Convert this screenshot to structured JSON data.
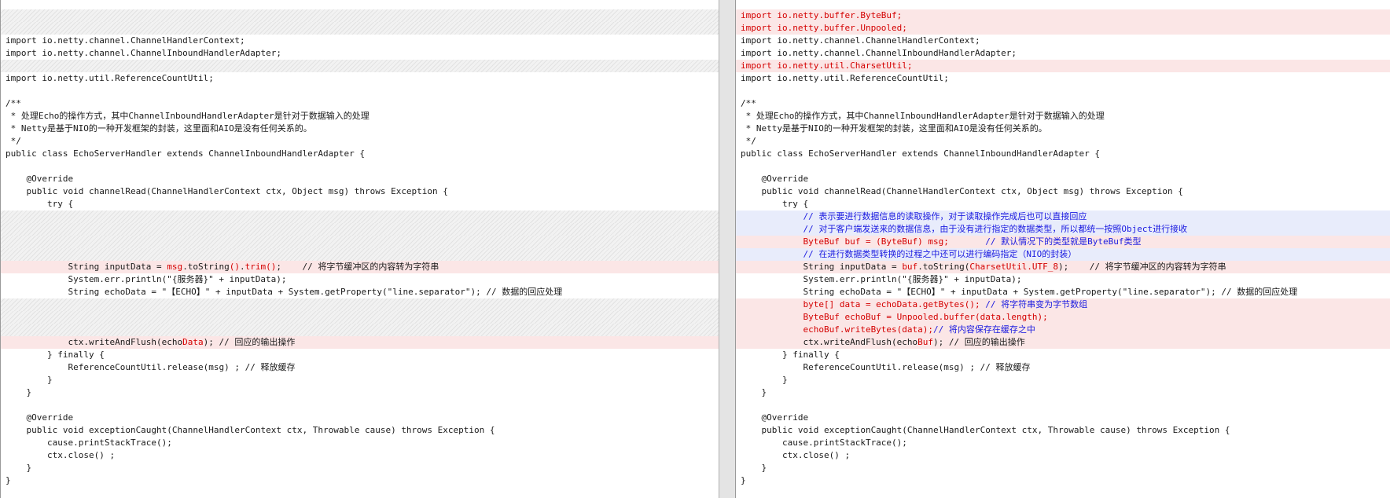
{
  "left": {
    "lines": [
      {
        "kind": "gap"
      },
      {
        "kind": "gap"
      },
      {
        "kind": "normal",
        "segments": [
          {
            "t": "import io.netty.channel.ChannelHandlerContext;"
          }
        ]
      },
      {
        "kind": "normal",
        "segments": [
          {
            "t": "import io.netty.channel.ChannelInboundHandlerAdapter;"
          }
        ]
      },
      {
        "kind": "gap"
      },
      {
        "kind": "normal",
        "segments": [
          {
            "t": "import io.netty.util.ReferenceCountUtil;"
          }
        ]
      },
      {
        "kind": "blank"
      },
      {
        "kind": "normal",
        "segments": [
          {
            "t": "/**"
          }
        ]
      },
      {
        "kind": "normal",
        "segments": [
          {
            "t": " * 处理Echo的操作方式，其中ChannelInboundHandlerAdapter是针对于数据输入的处理"
          }
        ]
      },
      {
        "kind": "normal",
        "segments": [
          {
            "t": " * Netty是基于NIO的一种开发框架的封装，这里面和AIO是没有任何关系的。"
          }
        ]
      },
      {
        "kind": "normal",
        "segments": [
          {
            "t": " */"
          }
        ]
      },
      {
        "kind": "normal",
        "segments": [
          {
            "t": "public class EchoServerHandler extends ChannelInboundHandlerAdapter {"
          }
        ]
      },
      {
        "kind": "blank"
      },
      {
        "kind": "normal",
        "segments": [
          {
            "t": "    @Override"
          }
        ]
      },
      {
        "kind": "normal",
        "segments": [
          {
            "t": "    public void channelRead(ChannelHandlerContext ctx, Object msg) throws Exception {"
          }
        ]
      },
      {
        "kind": "normal",
        "segments": [
          {
            "t": "        try {"
          }
        ]
      },
      {
        "kind": "gap"
      },
      {
        "kind": "gap"
      },
      {
        "kind": "gap"
      },
      {
        "kind": "gap"
      },
      {
        "kind": "changed",
        "segments": [
          {
            "t": "            String inputData = "
          },
          {
            "t": "msg",
            "c": "red"
          },
          {
            "t": ".toString"
          },
          {
            "t": "()",
            "c": "red"
          },
          {
            "t": "."
          },
          {
            "t": "trim()",
            "c": "red"
          },
          {
            "t": ";    // 将字节缓冲区的内容转为字符串"
          }
        ]
      },
      {
        "kind": "normal",
        "segments": [
          {
            "t": "            System.err.println(\"{服务器}\" + inputData);"
          }
        ]
      },
      {
        "kind": "normal",
        "segments": [
          {
            "t": "            String echoData = \"【ECHO】\" + inputData + System.getProperty(\"line.separator\"); // 数据的回应处理"
          }
        ]
      },
      {
        "kind": "gap"
      },
      {
        "kind": "gap"
      },
      {
        "kind": "gap"
      },
      {
        "kind": "changed",
        "segments": [
          {
            "t": "            ctx.writeAndFlush(echo"
          },
          {
            "t": "Data",
            "c": "red"
          },
          {
            "t": "); // 回应的输出操作"
          }
        ]
      },
      {
        "kind": "normal",
        "segments": [
          {
            "t": "        } finally {"
          }
        ]
      },
      {
        "kind": "normal",
        "segments": [
          {
            "t": "            ReferenceCountUtil.release(msg) ; // 释放缓存"
          }
        ]
      },
      {
        "kind": "normal",
        "segments": [
          {
            "t": "        }"
          }
        ]
      },
      {
        "kind": "normal",
        "segments": [
          {
            "t": "    }"
          }
        ]
      },
      {
        "kind": "blank"
      },
      {
        "kind": "normal",
        "segments": [
          {
            "t": "    @Override"
          }
        ]
      },
      {
        "kind": "normal",
        "segments": [
          {
            "t": "    public void exceptionCaught(ChannelHandlerContext ctx, Throwable cause) throws Exception {"
          }
        ]
      },
      {
        "kind": "normal",
        "segments": [
          {
            "t": "        cause.printStackTrace();"
          }
        ]
      },
      {
        "kind": "normal",
        "segments": [
          {
            "t": "        ctx.close() ;"
          }
        ]
      },
      {
        "kind": "normal",
        "segments": [
          {
            "t": "    }"
          }
        ]
      },
      {
        "kind": "normal",
        "segments": [
          {
            "t": "}"
          }
        ]
      }
    ]
  },
  "right": {
    "lines": [
      {
        "kind": "added",
        "segments": [
          {
            "t": "import io.netty.buffer.ByteBuf;"
          }
        ]
      },
      {
        "kind": "added",
        "segments": [
          {
            "t": "import io.netty.buffer.Unpooled;"
          }
        ]
      },
      {
        "kind": "normal",
        "segments": [
          {
            "t": "import io.netty.channel.ChannelHandlerContext;"
          }
        ]
      },
      {
        "kind": "normal",
        "segments": [
          {
            "t": "import io.netty.channel.ChannelInboundHandlerAdapter;"
          }
        ]
      },
      {
        "kind": "added",
        "segments": [
          {
            "t": "import io.netty.util.CharsetUtil;"
          }
        ]
      },
      {
        "kind": "normal",
        "segments": [
          {
            "t": "import io.netty.util.ReferenceCountUtil;"
          }
        ]
      },
      {
        "kind": "blank"
      },
      {
        "kind": "normal",
        "segments": [
          {
            "t": "/**"
          }
        ]
      },
      {
        "kind": "normal",
        "segments": [
          {
            "t": " * 处理Echo的操作方式，其中ChannelInboundHandlerAdapter是针对于数据输入的处理"
          }
        ]
      },
      {
        "kind": "normal",
        "segments": [
          {
            "t": " * Netty是基于NIO的一种开发框架的封装，这里面和AIO是没有任何关系的。"
          }
        ]
      },
      {
        "kind": "normal",
        "segments": [
          {
            "t": " */"
          }
        ]
      },
      {
        "kind": "normal",
        "segments": [
          {
            "t": "public class EchoServerHandler extends ChannelInboundHandlerAdapter {"
          }
        ]
      },
      {
        "kind": "blank"
      },
      {
        "kind": "normal",
        "segments": [
          {
            "t": "    @Override"
          }
        ]
      },
      {
        "kind": "normal",
        "segments": [
          {
            "t": "    public void channelRead(ChannelHandlerContext ctx, Object msg) throws Exception {"
          }
        ]
      },
      {
        "kind": "normal",
        "segments": [
          {
            "t": "        try {"
          }
        ]
      },
      {
        "kind": "added-comment",
        "segments": [
          {
            "t": "            // 表示要进行数据信息的读取操作，对于读取操作完成后也可以直接回应"
          }
        ]
      },
      {
        "kind": "added-comment",
        "segments": [
          {
            "t": "            // 对于客户端发送来的数据信息，由于没有进行指定的数据类型，所以都统一按照Object进行接收"
          }
        ]
      },
      {
        "kind": "added",
        "segments": [
          {
            "t": "            ByteBuf buf = (ByteBuf) msg;       "
          },
          {
            "t": "// 默认情况下的类型就是ByteBuf类型",
            "c": "blue"
          }
        ]
      },
      {
        "kind": "added-comment",
        "segments": [
          {
            "t": "            // 在进行数据类型转换的过程之中还可以进行编码指定（NIO的封装）"
          }
        ]
      },
      {
        "kind": "changed",
        "segments": [
          {
            "t": "            String inputData = "
          },
          {
            "t": "buf",
            "c": "red"
          },
          {
            "t": ".toString("
          },
          {
            "t": "CharsetUtil.UTF_8",
            "c": "red"
          },
          {
            "t": ");    // 将字节缓冲区的内容转为字符串"
          }
        ]
      },
      {
        "kind": "normal",
        "segments": [
          {
            "t": "            System.err.println(\"{服务器}\" + inputData);"
          }
        ]
      },
      {
        "kind": "normal",
        "segments": [
          {
            "t": "            String echoData = \"【ECHO】\" + inputData + System.getProperty(\"line.separator\"); // 数据的回应处理"
          }
        ]
      },
      {
        "kind": "added",
        "segments": [
          {
            "t": "            byte[] data = echoData.getBytes(); "
          },
          {
            "t": "// 将字符串变为字节数组",
            "c": "blue"
          }
        ]
      },
      {
        "kind": "added",
        "segments": [
          {
            "t": "            ByteBuf echoBuf = Unpooled.buffer(data.length);"
          }
        ]
      },
      {
        "kind": "added",
        "segments": [
          {
            "t": "            echoBuf.writeBytes(data);"
          },
          {
            "t": "// 将内容保存在缓存之中",
            "c": "blue"
          }
        ]
      },
      {
        "kind": "changed",
        "segments": [
          {
            "t": "            ctx.writeAndFlush(echo"
          },
          {
            "t": "Buf",
            "c": "red"
          },
          {
            "t": "); // 回应的输出操作"
          }
        ]
      },
      {
        "kind": "normal",
        "segments": [
          {
            "t": "        } finally {"
          }
        ]
      },
      {
        "kind": "normal",
        "segments": [
          {
            "t": "            ReferenceCountUtil.release(msg) ; // 释放缓存"
          }
        ]
      },
      {
        "kind": "normal",
        "segments": [
          {
            "t": "        }"
          }
        ]
      },
      {
        "kind": "normal",
        "segments": [
          {
            "t": "    }"
          }
        ]
      },
      {
        "kind": "blank"
      },
      {
        "kind": "normal",
        "segments": [
          {
            "t": "    @Override"
          }
        ]
      },
      {
        "kind": "normal",
        "segments": [
          {
            "t": "    public void exceptionCaught(ChannelHandlerContext ctx, Throwable cause) throws Exception {"
          }
        ]
      },
      {
        "kind": "normal",
        "segments": [
          {
            "t": "        cause.printStackTrace();"
          }
        ]
      },
      {
        "kind": "normal",
        "segments": [
          {
            "t": "        ctx.close() ;"
          }
        ]
      },
      {
        "kind": "normal",
        "segments": [
          {
            "t": "    }"
          }
        ]
      },
      {
        "kind": "normal",
        "segments": [
          {
            "t": "}"
          }
        ]
      }
    ]
  }
}
